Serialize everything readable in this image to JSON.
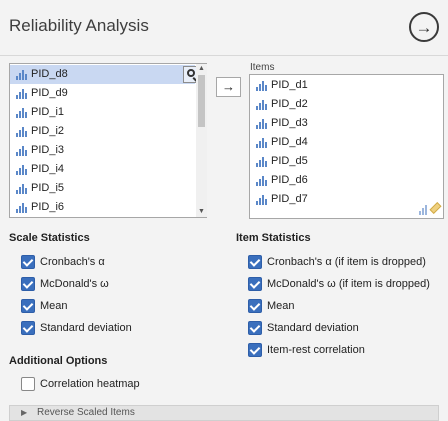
{
  "header": {
    "title": "Reliability Analysis"
  },
  "source_list": {
    "items": [
      "PID_d8",
      "PID_d9",
      "PID_i1",
      "PID_i2",
      "PID_i3",
      "PID_i4",
      "PID_i5",
      "PID_i6"
    ],
    "selected_index": 0
  },
  "target_list": {
    "label": "Items",
    "items": [
      "PID_d1",
      "PID_d2",
      "PID_d3",
      "PID_d4",
      "PID_d5",
      "PID_d6",
      "PID_d7"
    ]
  },
  "scale_statistics": {
    "title": "Scale Statistics",
    "options": [
      {
        "label": "Cronbach's α",
        "checked": true
      },
      {
        "label": "McDonald's ω",
        "checked": true
      },
      {
        "label": "Mean",
        "checked": true
      },
      {
        "label": "Standard deviation",
        "checked": true
      }
    ]
  },
  "item_statistics": {
    "title": "Item Statistics",
    "options": [
      {
        "label": "Cronbach's α (if item is dropped)",
        "checked": true
      },
      {
        "label": "McDonald's ω (if item is dropped)",
        "checked": true
      },
      {
        "label": "Mean",
        "checked": true
      },
      {
        "label": "Standard deviation",
        "checked": true
      },
      {
        "label": "Item-rest correlation",
        "checked": true
      }
    ]
  },
  "additional_options": {
    "title": "Additional Options",
    "options": [
      {
        "label": "Correlation heatmap",
        "checked": false
      }
    ]
  },
  "collapsed_panel": {
    "label": "Reverse Scaled Items"
  },
  "colors": {
    "accent": "#3a6fbd",
    "selection": "#c9d8f2",
    "variable_icon": "#5a87c8"
  }
}
